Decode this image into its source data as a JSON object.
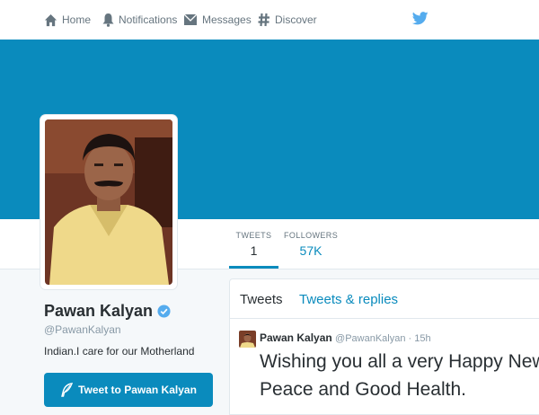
{
  "nav": {
    "home": "Home",
    "notifications": "Notifications",
    "messages": "Messages",
    "discover": "Discover"
  },
  "profile": {
    "name": "Pawan Kalyan",
    "handle": "@PawanKalyan",
    "bio": "Indian.I care for our Motherland",
    "tweet_to_label": "Tweet to Pawan Kalyan"
  },
  "stats": {
    "tweets_label": "TWEETS",
    "tweets_value": "1",
    "followers_label": "FOLLOWERS",
    "followers_value": "57K"
  },
  "timeline": {
    "tabs": [
      "Tweets",
      "Tweets & replies"
    ],
    "tweet": {
      "name": "Pawan Kalyan",
      "handle": "@PawanKalyan",
      "separator": " · ",
      "time": "15h",
      "text_line1": "Wishing you all a very Happy New Ye",
      "text_line2": "Peace and Good Health."
    }
  },
  "colors": {
    "accent": "#0a8bbd",
    "banner": "#0a8bbd",
    "background": "#f5f8fa"
  },
  "icons": [
    "home-icon",
    "bell-icon",
    "envelope-icon",
    "hashtag-icon",
    "twitter-bird-icon",
    "verified-badge-icon",
    "quill-icon"
  ]
}
